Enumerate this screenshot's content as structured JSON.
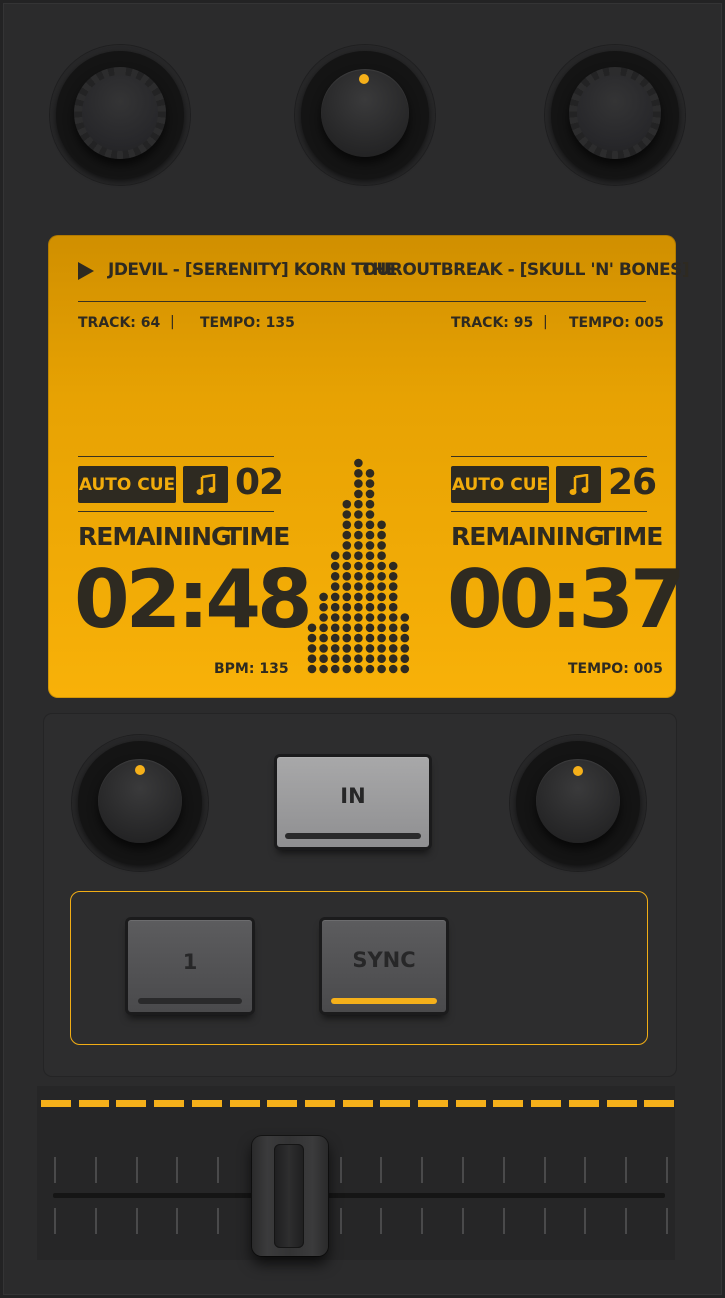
{
  "colors": {
    "accent": "#f5b01a",
    "lcd_top": "#d08f00",
    "lcd_bottom": "#f8b108",
    "lcd_ink": "#2e2a21",
    "panel": "#2b2b2c"
  },
  "display": {
    "now_playing_left": "JDEVIL - [SERENITY] KORN TOUR",
    "now_playing_right": "THE OUTBREAK - [SKULL 'N' BONES]",
    "left": {
      "track": "TRACK: 64",
      "tempo": "TEMPO: 135",
      "cue_label": "AUTO CUE",
      "cue_number": "02",
      "remaining_label": "REMAINING",
      "time_label": "TIME",
      "time": "02:48",
      "footer": "BPM: 135"
    },
    "right": {
      "track": "TRACK: 95",
      "tempo": "TEMPO: 005",
      "cue_label": "AUTO CUE",
      "cue_number": "26",
      "remaining_label": "REMAINING",
      "time_label": "TIME",
      "time": "00:37",
      "footer": "TEMPO: 005"
    },
    "separator": "|",
    "spectrum_levels": [
      5,
      8,
      12,
      17,
      21,
      20,
      15,
      11,
      6
    ]
  },
  "controls": {
    "in_label": "IN",
    "pad1_label": "1",
    "sync_label": "SYNC"
  },
  "icons": {
    "play": "play-icon",
    "music": "music-note-icon",
    "knob": "knob-icon"
  }
}
